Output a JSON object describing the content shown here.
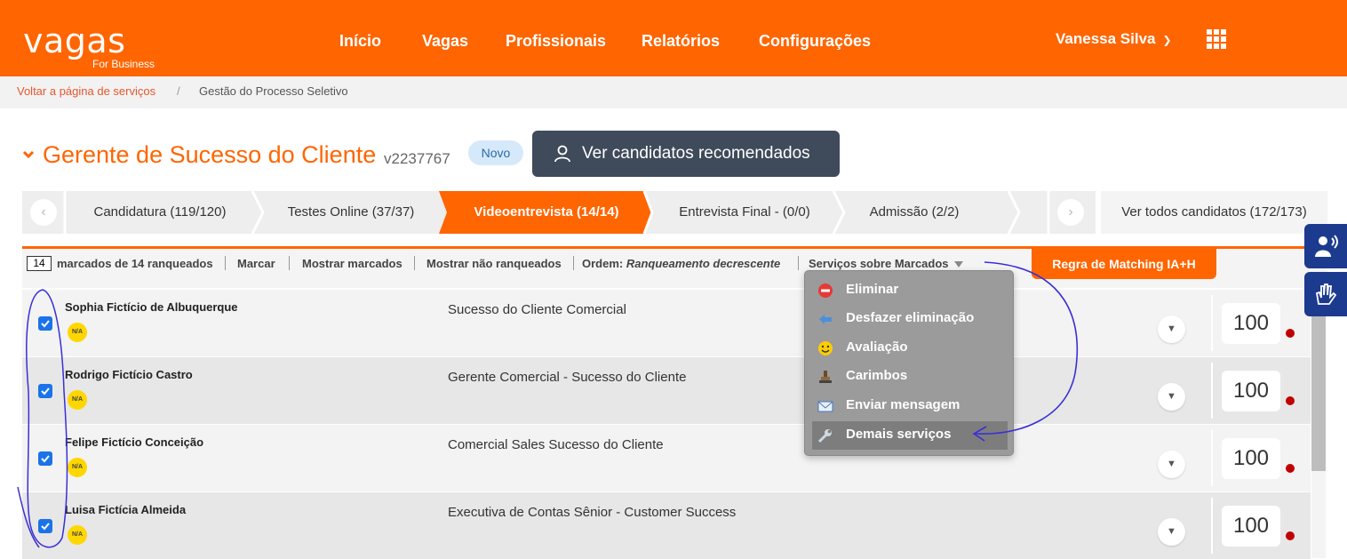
{
  "header": {
    "logo_main": "vagas",
    "logo_sub": "For Business",
    "nav": [
      "Início",
      "Vagas",
      "Profissionais",
      "Relatórios",
      "Configurações"
    ],
    "user_name": "Vanessa Silva",
    "colors": {
      "brand": "#ff6500",
      "dark_button": "#3f4a5a",
      "accessibility": "#1c3b8e"
    }
  },
  "breadcrumb": {
    "back_link": "Voltar a página de serviços",
    "separator": "/",
    "current": "Gestão do Processo Seletivo"
  },
  "job": {
    "title": "Gerente de Sucesso do Cliente",
    "code": "v2237767",
    "badge": "Novo",
    "recommended_button": "Ver candidatos recomendados"
  },
  "stages": {
    "items": [
      {
        "label": "Candidatura (119/120)",
        "active": false
      },
      {
        "label": "Testes Online (37/37)",
        "active": false
      },
      {
        "label": "Videoentrevista (14/14)",
        "active": true
      },
      {
        "label": "Entrevista Final - (0/0)",
        "active": false
      },
      {
        "label": "Admissão (2/2)",
        "active": false
      }
    ],
    "see_all": "Ver todos candidatos (172/173)"
  },
  "toolbar": {
    "marked_count": "14",
    "marked_text": "marcados de 14 ranqueados",
    "mark": "Marcar",
    "show_marked": "Mostrar marcados",
    "show_unranked": "Mostrar não ranqueados",
    "order_label": "Ordem:",
    "order_value": "Ranqueamento decrescente",
    "services": "Serviços sobre Marcados",
    "matching_button": "Regra de Matching IA+H"
  },
  "services_menu": [
    {
      "label": "Eliminar",
      "icon": "no-entry-icon"
    },
    {
      "label": "Desfazer eliminação",
      "icon": "undo-arrow-icon"
    },
    {
      "label": "Avaliação",
      "icon": "smiley-icon"
    },
    {
      "label": "Carimbos",
      "icon": "stamp-icon"
    },
    {
      "label": "Enviar mensagem",
      "icon": "envelope-icon"
    },
    {
      "label": "Demais serviços",
      "icon": "wrench-icon",
      "highlighted": true
    }
  ],
  "candidates": [
    {
      "name": "Sophia Fictício de Albuquerque",
      "badge": "N/A",
      "position": "Sucesso do Cliente Comercial",
      "score": "100",
      "checked": true
    },
    {
      "name": "Rodrigo Fictício Castro",
      "badge": "N/A",
      "position": "Gerente Comercial - Sucesso do Cliente",
      "score": "100",
      "checked": true
    },
    {
      "name": "Felipe Fictício Conceição",
      "badge": "N/A",
      "position": "Comercial Sales Sucesso do Cliente",
      "score": "100",
      "checked": true
    },
    {
      "name": "Luisa Fictícia Almeida",
      "badge": "N/A",
      "position": "Executiva de Contas Sênior - Customer Success",
      "score": "100",
      "checked": true
    }
  ]
}
